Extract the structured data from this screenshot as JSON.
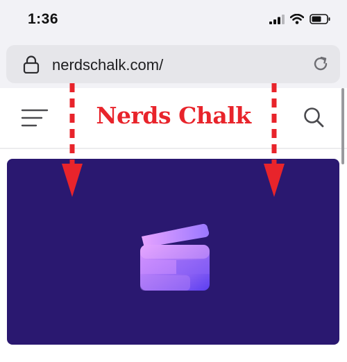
{
  "status_bar": {
    "time": "1:36",
    "icons": [
      "cellular-signal-icon",
      "wifi-icon",
      "battery-icon"
    ]
  },
  "address_bar": {
    "url": "nerdschalk.com/",
    "icons": [
      "lock-icon",
      "reload-icon"
    ]
  },
  "site_header": {
    "logo_text": "Nerds Chalk",
    "logo_color": "#e8242b",
    "icons": [
      "menu-icon",
      "search-icon"
    ]
  },
  "hero": {
    "background": "#2a1870",
    "icon": "clapperboard-icon"
  },
  "annotations": {
    "color": "#e8242b",
    "arrows": [
      "down-arrow-left",
      "down-arrow-right"
    ]
  }
}
